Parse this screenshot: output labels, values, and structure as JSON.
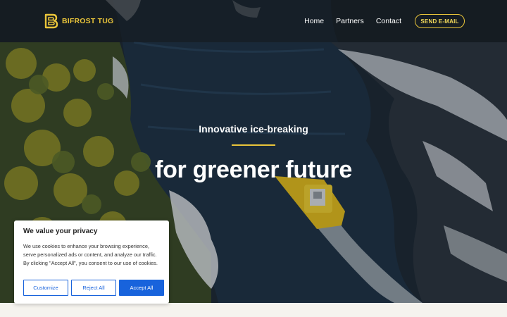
{
  "brand": {
    "name": "BIFROST TUG",
    "accent": "#e9c43a"
  },
  "nav": {
    "links": [
      "Home",
      "Partners",
      "Contact"
    ],
    "cta": "SEND E-MAIL"
  },
  "hero": {
    "subtitle": "Innovative ice-breaking",
    "title": "for greener future"
  },
  "cookie": {
    "title": "We value your privacy",
    "text": "We use cookies to enhance your browsing experience, serve personalized ads or content, and analyze our traffic. By clicking \"Accept All\", you consent to our use of cookies.",
    "buttons": {
      "customize": "Customize",
      "reject": "Reject All",
      "accept": "Accept All"
    },
    "accent": "#1863dc"
  }
}
